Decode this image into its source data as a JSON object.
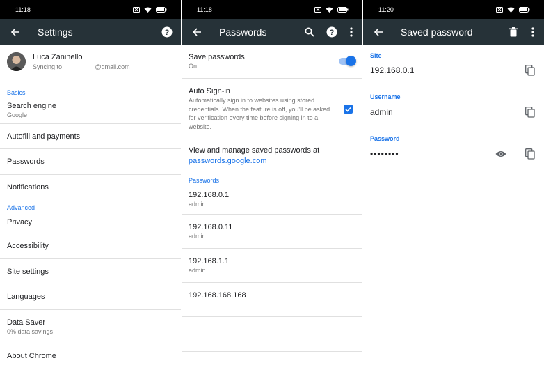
{
  "screen1": {
    "status": {
      "time": "11:18"
    },
    "appbar": {
      "title": "Settings"
    },
    "account": {
      "name": "Luca Zaninello",
      "sync_text": "Syncing to                   @gmail.com"
    },
    "basics_label": "Basics",
    "search_engine": {
      "label": "Search engine",
      "value": "Google"
    },
    "items_basic": [
      "Autofill and payments",
      "Passwords",
      "Notifications"
    ],
    "advanced_label": "Advanced",
    "items_advanced": [
      "Privacy",
      "Accessibility",
      "Site settings",
      "Languages"
    ],
    "data_saver": {
      "label": "Data Saver",
      "value": "0% data savings"
    },
    "about": "About Chrome"
  },
  "screen2": {
    "status": {
      "time": "11:18"
    },
    "appbar": {
      "title": "Passwords"
    },
    "save_passwords": {
      "label": "Save passwords",
      "value": "On",
      "enabled": true
    },
    "auto_signin": {
      "label": "Auto Sign-in",
      "description": "Automatically sign in to websites using stored credentials. When the feature is off, you'll be asked for verification every time before signing in to a website.",
      "checked": true
    },
    "manage": {
      "text": "View and manage saved passwords at",
      "link": "passwords.google.com"
    },
    "passwords_label": "Passwords",
    "entries": [
      {
        "site": "192.168.0.1",
        "user": "admin"
      },
      {
        "site": "192.168.0.11",
        "user": "admin"
      },
      {
        "site": "192.168.1.1",
        "user": "admin"
      },
      {
        "site": "192.168.168.168",
        "user": ""
      }
    ]
  },
  "screen3": {
    "status": {
      "time": "11:20"
    },
    "appbar": {
      "title": "Saved password"
    },
    "site": {
      "label": "Site",
      "value": "192.168.0.1"
    },
    "username": {
      "label": "Username",
      "value": "admin"
    },
    "password": {
      "label": "Password",
      "value": "••••••••"
    }
  },
  "colors": {
    "appbar": "#263238",
    "accent": "#1a73e8",
    "statusbar": "#000000"
  }
}
